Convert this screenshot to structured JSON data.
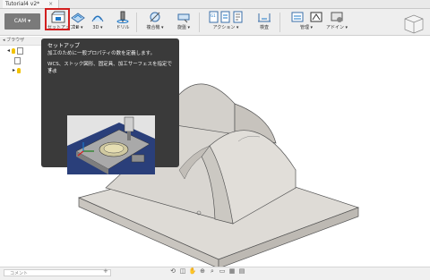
{
  "window": {
    "tab_title": "Tutorial4 v2*",
    "tab_close": "×"
  },
  "toolbar": {
    "workspace": "CAM ▾",
    "tools": [
      {
        "label": "セットアップ ▾",
        "icon": "setup-icon"
      },
      {
        "label": "2D ▾",
        "icon": "2d-icon"
      },
      {
        "label": "3D ▾",
        "icon": "3d-icon"
      },
      {
        "label": "ドリル",
        "icon": "drill-icon"
      },
      {
        "label": "複合機 ▾",
        "icon": "multiaxis-icon"
      },
      {
        "label": "旋盤 ▾",
        "icon": "turning-icon"
      },
      {
        "label": "アクション ▾",
        "icon": "actions-icon"
      },
      {
        "label": "検査",
        "icon": "inspect-icon"
      },
      {
        "label": "管理 ▾",
        "icon": "manage-icon"
      },
      {
        "label": "アドイン ▾",
        "icon": "addins-icon"
      }
    ]
  },
  "browser": {
    "title": "◂ ブラウザ"
  },
  "tooltip": {
    "title": "セットアップ",
    "line1": "加工のために一般プロパティの数を定義します。",
    "line2": "WCS、ストック図形、固定具、加工サーフェスを指定できま",
    "line3": "す。"
  },
  "bottom": {
    "comment_label": "コメント",
    "comment_add": "+"
  },
  "colors": {
    "highlight": "#d21f1f",
    "tooltip_bg": "#3a3a3a",
    "part": "#d9d6d1"
  }
}
